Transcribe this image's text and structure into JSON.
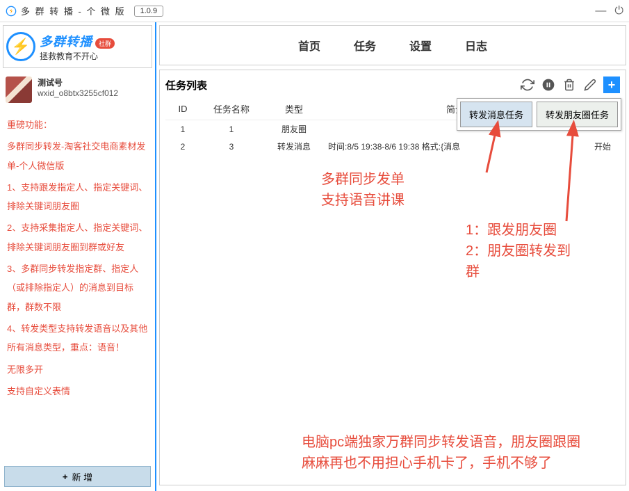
{
  "titlebar": {
    "title": "多 群 转 播 - 个 微 版",
    "version": "1.0.9"
  },
  "logo": {
    "main": "多群转播",
    "badge": "社群",
    "sub": "拯救教育不开心"
  },
  "user": {
    "name": "测试号",
    "id": "wxid_o8btx3255cf012"
  },
  "features": {
    "heading": "重磅功能：",
    "subtitle": "多群同步转发-淘客社交电商素材发单-个人微信版",
    "items": [
      "1、支持跟发指定人、指定关键词、排除关键词朋友圈",
      "2、支持采集指定人、指定关键词、排除关键词朋友圈到群或好友",
      "3、多群同步转发指定群、指定人（或排除指定人）的消息到目标群，群数不限",
      "4、转发类型支持转发语音以及其他所有消息类型，重点：语音！"
    ],
    "extra1": "无限多开",
    "extra2": "支持自定义表情"
  },
  "addBtn": "新 增",
  "nav": [
    "首页",
    "任务",
    "设置",
    "日志"
  ],
  "panel": {
    "title": "任务列表",
    "headers": {
      "id": "ID",
      "name": "任务名称",
      "type": "类型",
      "intro": "简介",
      "status": ""
    },
    "rows": [
      {
        "id": "1",
        "name": "1",
        "type": "朋友圈",
        "intro": "",
        "status": ""
      },
      {
        "id": "2",
        "name": "3",
        "type": "转发消息",
        "intro": "时间:8/5 19:38-8/6 19:38 格式:{消息",
        "status": "开始"
      }
    ]
  },
  "popup": {
    "btn1": "转发消息任务",
    "btn2": "转发朋友圈任务"
  },
  "anno": {
    "a1_l1": "多群同步发单",
    "a1_l2": "支持语音讲课",
    "a2_l1": "1：跟发朋友圈",
    "a2_l2": "2：朋友圈转发到",
    "a2_l3": "群",
    "a3_l1": "电脑pc端独家万群同步转发语音，朋友圈跟圈",
    "a3_l2": "麻麻再也不用担心手机卡了，手机不够了"
  }
}
